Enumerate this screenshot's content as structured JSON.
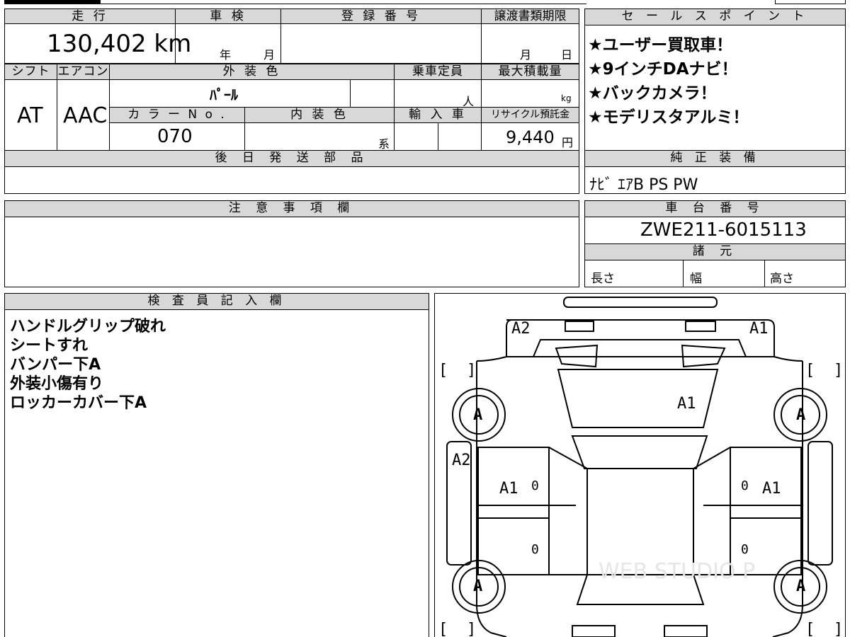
{
  "top_form": {
    "mileage_label": "走 行",
    "mileage_value": "130,402 km",
    "inspection_label": "車 検",
    "inspection_year": "年",
    "inspection_month": "月",
    "registration_label": "登 録 番 号",
    "transfer_deadline_label": "譲渡書類期限",
    "transfer_month": "月",
    "transfer_day": "日",
    "shift_label": "シフト",
    "shift_value": "AT",
    "aircon_label": "エアコン",
    "aircon_value": "AAC",
    "exterior_color_label": "外 装 色",
    "exterior_color_value": "ﾊﾟｰﾙ",
    "capacity_label": "乗車定員",
    "capacity_unit": "人",
    "max_load_label": "最大積載量",
    "max_load_unit": "kg",
    "color_no_label": "カ ラ ー N o .",
    "color_no_value": "070",
    "interior_color_label": "内 装 色",
    "interior_color_suffix": "系",
    "import_label": "輸 入 車",
    "recycle_label": "リサイクル預託金",
    "recycle_value": "9,440",
    "recycle_unit": "円"
  },
  "sales_points": {
    "header": "セ ー ル ス ポ イ ン ト",
    "items": [
      "★ユーザー買取車！",
      "★9インチDAナビ！",
      "★バックカメラ！",
      "★モデリスタアルミ！"
    ]
  },
  "later_parts": {
    "header": "後 日 発 送 部 品",
    "value": ""
  },
  "standard_equipment": {
    "header": "純 正 装 備",
    "value": "ﾅﾋﾞ ｴｱB PS PW"
  },
  "notes": {
    "header": "注 意 事 項 欄",
    "value": ""
  },
  "chassis": {
    "header": "車 台 番 号",
    "value": "ZWE211-6015113"
  },
  "specs": {
    "header": "諸 元",
    "length": "長さ",
    "width": "幅",
    "height": "高さ"
  },
  "inspector": {
    "header": "検 査 員 記 入 欄",
    "lines": [
      "ハンドルグリップ破れ",
      "シートすれ",
      "バンパー下A",
      "外装小傷有り",
      "ロッカーカバー下A"
    ]
  },
  "diagram": {
    "front_left": "A2",
    "front_right": "A1",
    "hood": "A1",
    "left_fender": "A2",
    "left_door": "A1",
    "right_door": "A1",
    "tire_fl": "A",
    "tire_fr": "A",
    "tire_rl": "A",
    "tire_rr": "A",
    "zero_left_front": "0",
    "zero_left_rear": "0",
    "zero_right_front": "0",
    "zero_right_rear": "0",
    "watermark": "WEB STUDIO P"
  }
}
